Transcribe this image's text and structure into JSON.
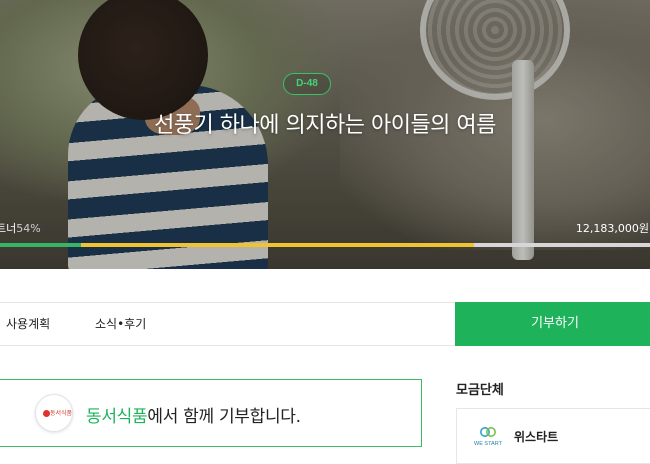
{
  "hero": {
    "dday_badge": "D-48",
    "title": "선풍기 하나에 의지하는 아이들의 여름",
    "progress_label_prefix": "트너",
    "progress_percent_text": "54%",
    "amount_text": "12,183,000원 ,",
    "progress": {
      "green_fraction": 0.124,
      "yellow_fraction": 0.606
    },
    "colors": {
      "green": "#37b565",
      "yellow": "#f1c232",
      "track": "#d7d7d7"
    }
  },
  "tabs": [
    {
      "label": "사용계획"
    },
    {
      "label": "소식•후기"
    }
  ],
  "donate_button": {
    "label": "기부하기",
    "color": "#1eb35a"
  },
  "sponsor": {
    "logo_text": "동서식품",
    "brand": "동서식품",
    "message_suffix": "에서 함께 기부합니다."
  },
  "organization": {
    "heading": "모금단체",
    "logo_caption": "WE START",
    "name": "위스타트"
  }
}
